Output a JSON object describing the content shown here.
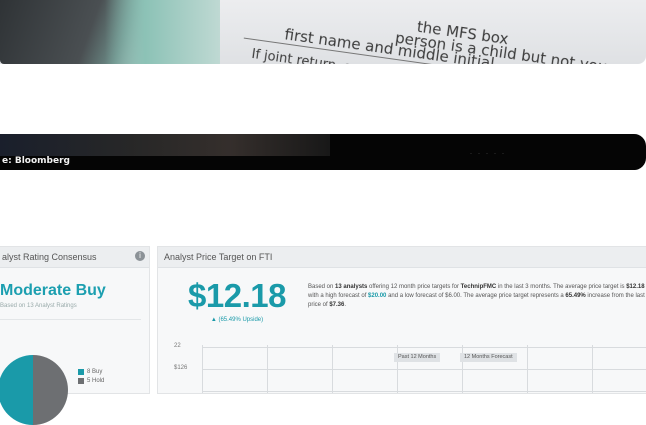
{
  "photo": {
    "form_lines": [
      "the MFS box",
      "person is a child but not your",
      "first name and middle initial",
      "If joint return, spo"
    ]
  },
  "video": {
    "credit": "e: Bloomberg"
  },
  "rating_panel": {
    "header": "alyst Rating Consensus",
    "consensus": "Moderate Buy",
    "subtitle": "Based on 13 Analyst Ratings",
    "legend": [
      {
        "label": "8 Buy",
        "color": "#1a9aa9"
      },
      {
        "label": "5 Hold",
        "color": "#6d6f72"
      }
    ],
    "info_icon": "info-icon"
  },
  "target_panel": {
    "header": "Analyst Price Target on FTI",
    "price": "$12.18",
    "upside": "▲ (65.49% Upside)",
    "desc_parts": {
      "p1": "Based on ",
      "analysts": "13 analysts",
      "p2": " offering 12 month price targets for ",
      "company": "TechnipFMC",
      "p3": " in the last 3 months. The average price target is ",
      "avg": "$12.18",
      "p4": " with a high forecast of ",
      "high": "$20.00",
      "p5": " and a low forecast of $6.00. The average price target represents a ",
      "pct": "65.49%",
      "p6": " increase from the last price of ",
      "last": "$7.36",
      "p7": "."
    },
    "chart": {
      "y_ticks": [
        "22",
        "$126"
      ],
      "tags": [
        "Past 12 Months",
        "12 Months Forecast"
      ]
    }
  },
  "colors": {
    "accent": "#1a9aa9",
    "hold": "#6d6f72"
  }
}
